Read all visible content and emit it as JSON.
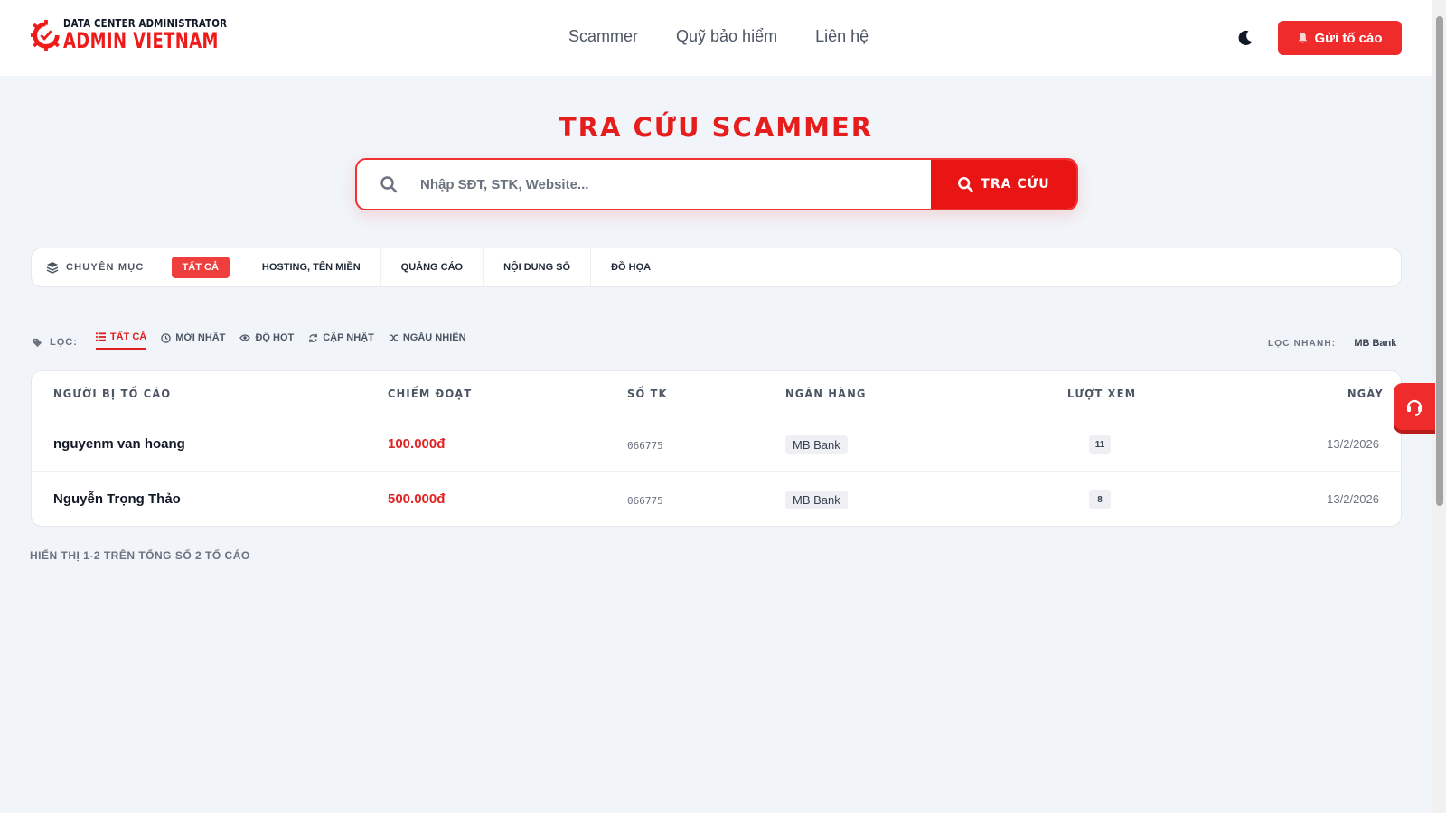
{
  "brand": {
    "line1": "DATA CENTER ADMINISTRATOR",
    "line2": "ADMIN VIETNAM",
    "accent": "#ef1b1b"
  },
  "nav": {
    "items": [
      "Scammer",
      "Quỹ bảo hiểm",
      "Liên hệ"
    ]
  },
  "header": {
    "theme_icon": "moon-icon",
    "report_button": "Gửi tố cáo",
    "report_icon": "bell-icon"
  },
  "search": {
    "title": "TRA CỨU SCAMMER",
    "placeholder": "Nhập SĐT, STK, Website...",
    "button": "TRA CỨU"
  },
  "categories": {
    "label": "CHUYÊN MỤC",
    "items": [
      "TẤT CẢ",
      "HOSTING, TÊN MIỀN",
      "QUẢNG CÁO",
      "NỘI DUNG SỐ",
      "ĐỒ HỌA"
    ],
    "active": "TẤT CẢ"
  },
  "filters": {
    "label": "LỌC:",
    "items": [
      {
        "label": "TẤT CẢ",
        "icon": "list-icon"
      },
      {
        "label": "MỚI NHẤT",
        "icon": "clock-icon"
      },
      {
        "label": "ĐỘ HOT",
        "icon": "eye-icon"
      },
      {
        "label": "CẬP NHẬT",
        "icon": "refresh-icon"
      },
      {
        "label": "NGẪU NHIÊN",
        "icon": "shuffle-icon"
      }
    ],
    "quick_label": "LỌC NHANH:",
    "quick_items": [
      "MB Bank"
    ]
  },
  "table": {
    "columns": [
      "NGƯỜI BỊ TỐ CÁO",
      "CHIẾM ĐOẠT",
      "SỐ TK",
      "NGÂN HÀNG",
      "LƯỢT XEM",
      "NGÀY"
    ],
    "rows": [
      {
        "name": "nguyenm van hoang",
        "amount": "100.000đ",
        "account": "066775",
        "bank": "MB Bank",
        "views": "11",
        "date": "13/2/2026"
      },
      {
        "name": "Nguyễn Trọng Thảo",
        "amount": "500.000đ",
        "account": "066775",
        "bank": "MB Bank",
        "views": "8",
        "date": "13/2/2026"
      }
    ]
  },
  "summary": "HIỂN THỊ 1-2 TRÊN TỔNG SỐ 2 TỐ CÁO",
  "support_icon": "headset-icon"
}
